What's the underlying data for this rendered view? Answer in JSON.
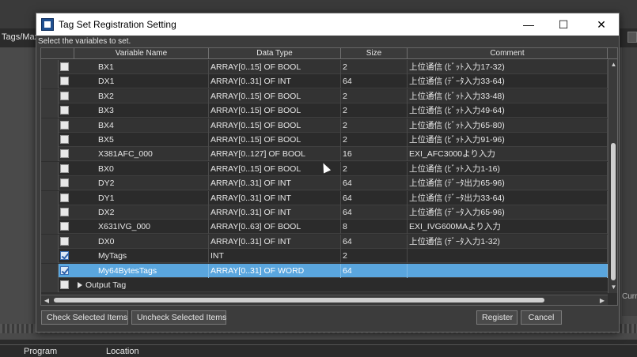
{
  "background": {
    "tab_label": "Tags/Max",
    "status_items": [
      "Program",
      "Location"
    ],
    "right_label": "Curr"
  },
  "dialog": {
    "title": "Tag Set Registration Setting",
    "minimize_glyph": "—",
    "maximize_glyph": "☐",
    "close_glyph": "✕",
    "instruction": "Select the variables to set.",
    "columns": [
      "Variable Name",
      "Data Type",
      "Size",
      "Comment"
    ],
    "rows": [
      {
        "name": "BX1",
        "type": "ARRAY[0..15] OF BOOL",
        "size": "2",
        "comment": "上位通信 (ﾋﾞｯﾄ入力17-32)",
        "checked": false
      },
      {
        "name": "DX1",
        "type": "ARRAY[0..31] OF INT",
        "size": "64",
        "comment": "上位通信 (ﾃﾞｰﾀ入力33-64)",
        "checked": false
      },
      {
        "name": "BX2",
        "type": "ARRAY[0..15] OF BOOL",
        "size": "2",
        "comment": "上位通信 (ﾋﾞｯﾄ入力33-48)",
        "checked": false
      },
      {
        "name": "BX3",
        "type": "ARRAY[0..15] OF BOOL",
        "size": "2",
        "comment": "上位通信 (ﾋﾞｯﾄ入力49-64)",
        "checked": false
      },
      {
        "name": "BX4",
        "type": "ARRAY[0..15] OF BOOL",
        "size": "2",
        "comment": "上位通信 (ﾋﾞｯﾄ入力65-80)",
        "checked": false
      },
      {
        "name": "BX5",
        "type": "ARRAY[0..15] OF BOOL",
        "size": "2",
        "comment": "上位通信 (ﾋﾞｯﾄ入力91-96)",
        "checked": false
      },
      {
        "name": "X381AFC_000",
        "type": "ARRAY[0..127] OF BOOL",
        "size": "16",
        "comment": "EXI_AFC3000より入力",
        "checked": false
      },
      {
        "name": "BX0",
        "type": "ARRAY[0..15] OF BOOL",
        "size": "2",
        "comment": "上位通信 (ﾋﾞｯﾄ入力1-16)",
        "checked": false
      },
      {
        "name": "DY2",
        "type": "ARRAY[0..31] OF INT",
        "size": "64",
        "comment": "上位通信 (ﾃﾞｰﾀ出力65-96)",
        "checked": false
      },
      {
        "name": "DY1",
        "type": "ARRAY[0..31] OF INT",
        "size": "64",
        "comment": "上位通信 (ﾃﾞｰﾀ出力33-64)",
        "checked": false
      },
      {
        "name": "DX2",
        "type": "ARRAY[0..31] OF INT",
        "size": "64",
        "comment": "上位通信 (ﾃﾞｰﾀ入力65-96)",
        "checked": false
      },
      {
        "name": "X631IVG_000",
        "type": "ARRAY[0..63] OF BOOL",
        "size": "8",
        "comment": "EXI_IVG600MAより入力",
        "checked": false
      },
      {
        "name": "DX0",
        "type": "ARRAY[0..31] OF INT",
        "size": "64",
        "comment": "上位通信 (ﾃﾞｰﾀ入力1-32)",
        "checked": false
      },
      {
        "name": "MyTags",
        "type": "INT",
        "size": "2",
        "comment": "",
        "checked": true
      },
      {
        "name": "My64BytesTags",
        "type": "ARRAY[0..31] OF WORD",
        "size": "64",
        "comment": "",
        "checked": true,
        "selected": true
      }
    ],
    "group_row": {
      "label": "Output Tag",
      "checked": false
    },
    "buttons": {
      "check_selected": "Check Selected Items",
      "uncheck_selected": "Uncheck Selected Items",
      "register": "Register",
      "cancel": "Cancel"
    }
  }
}
